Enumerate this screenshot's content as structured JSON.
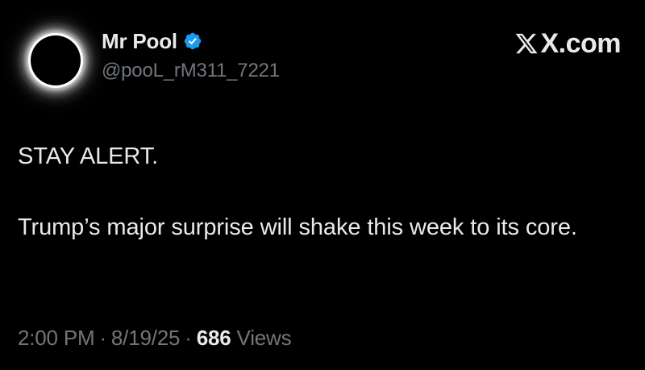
{
  "post": {
    "author": {
      "display_name": "Mr Pool",
      "handle": "@pooL_rM311_7221",
      "verified": true,
      "avatar_icon": "solar-eclipse-avatar"
    },
    "brand": {
      "text": "X.com",
      "icon": "x-logo-icon"
    },
    "text": {
      "line1": "STAY ALERT.",
      "line2": "Trump’s major surprise will shake this week to its core."
    },
    "meta": {
      "time": "2:00 PM",
      "separator": "·",
      "date": "8/19/25",
      "views_count": "686",
      "views_label": "Views"
    }
  },
  "colors": {
    "background": "#000000",
    "primary_text": "#e7e9ea",
    "secondary_text": "#71767b",
    "verified_blue": "#1d9bf0"
  }
}
